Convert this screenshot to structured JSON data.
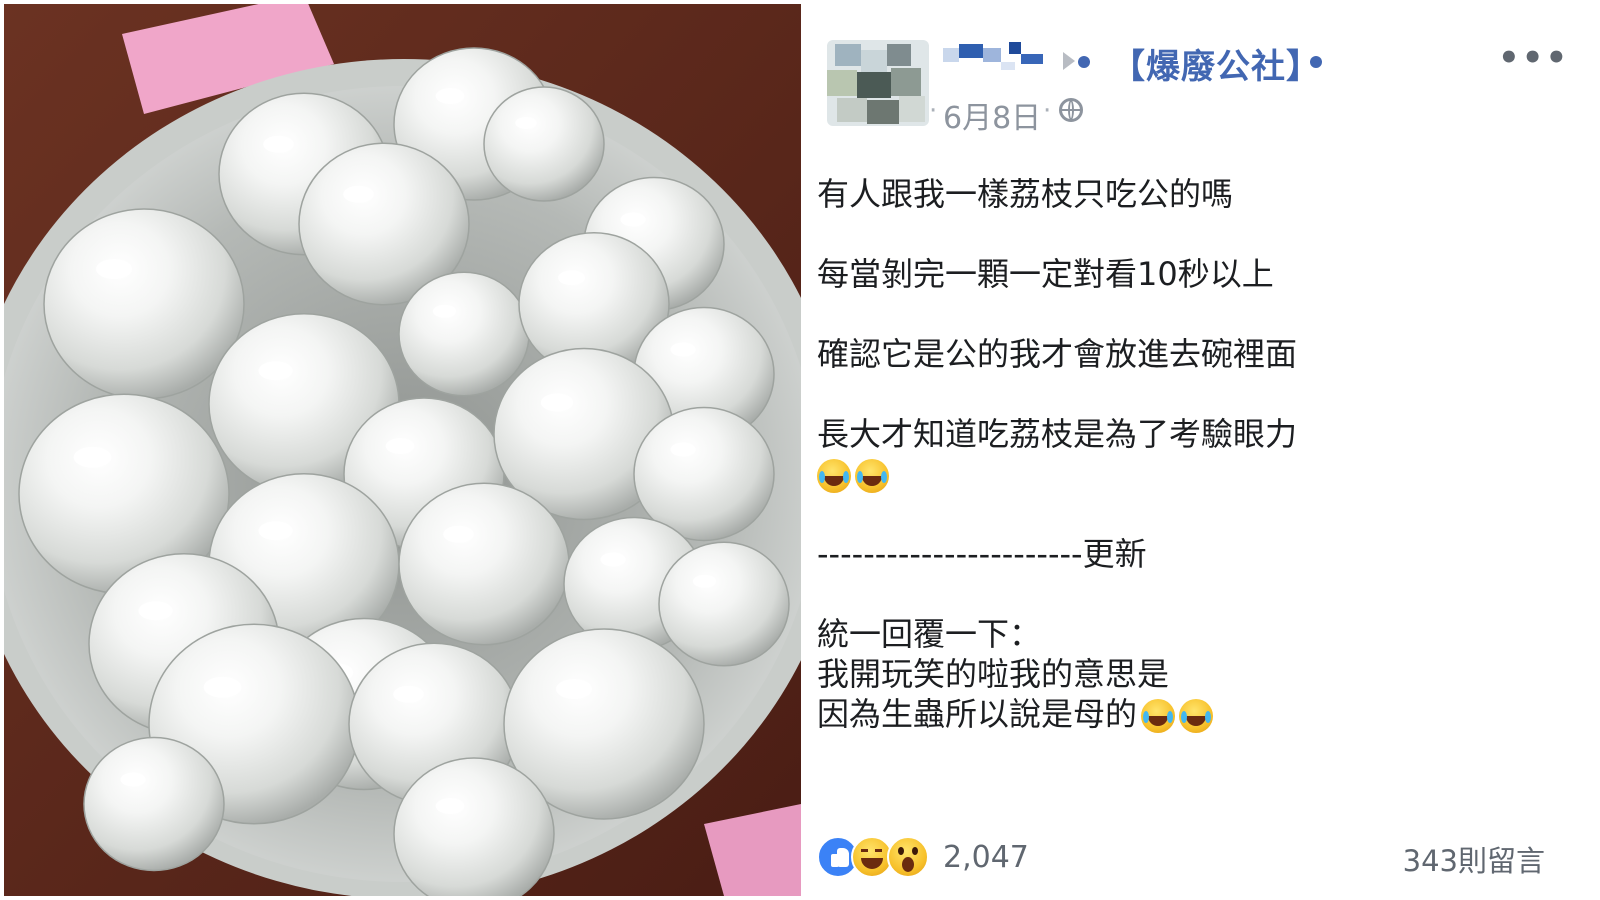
{
  "post": {
    "group_name": "【爆廢公社】",
    "date": "6月8日",
    "paragraphs": [
      "有人跟我一樣荔枝只吃公的嗎",
      "每當剝完一顆一定對看10秒以上",
      "確認它是公的我才會放進去碗裡面",
      "長大才知道吃荔枝是為了考驗眼力",
      "-----------------------更新",
      "統一回覆一下：",
      "我開玩笑的啦我的意思是",
      "因為生蟲所以說是母的"
    ],
    "icons": {
      "privacy": "globe-icon",
      "more": "more-options-icon",
      "separator": "triangle-right-icon",
      "laugh_emoji": "tears-of-joy-emoji",
      "rofl_emoji": "rolling-on-floor-laughing-emoji"
    }
  },
  "footer": {
    "reaction_count": "2,047",
    "comment_count": "343則留言",
    "reactions": [
      "like-reaction-icon",
      "haha-reaction-icon",
      "wow-reaction-icon"
    ]
  },
  "colors": {
    "link": "#4267b2",
    "meta_text": "#8d949e",
    "body_text": "#1c1e21"
  }
}
